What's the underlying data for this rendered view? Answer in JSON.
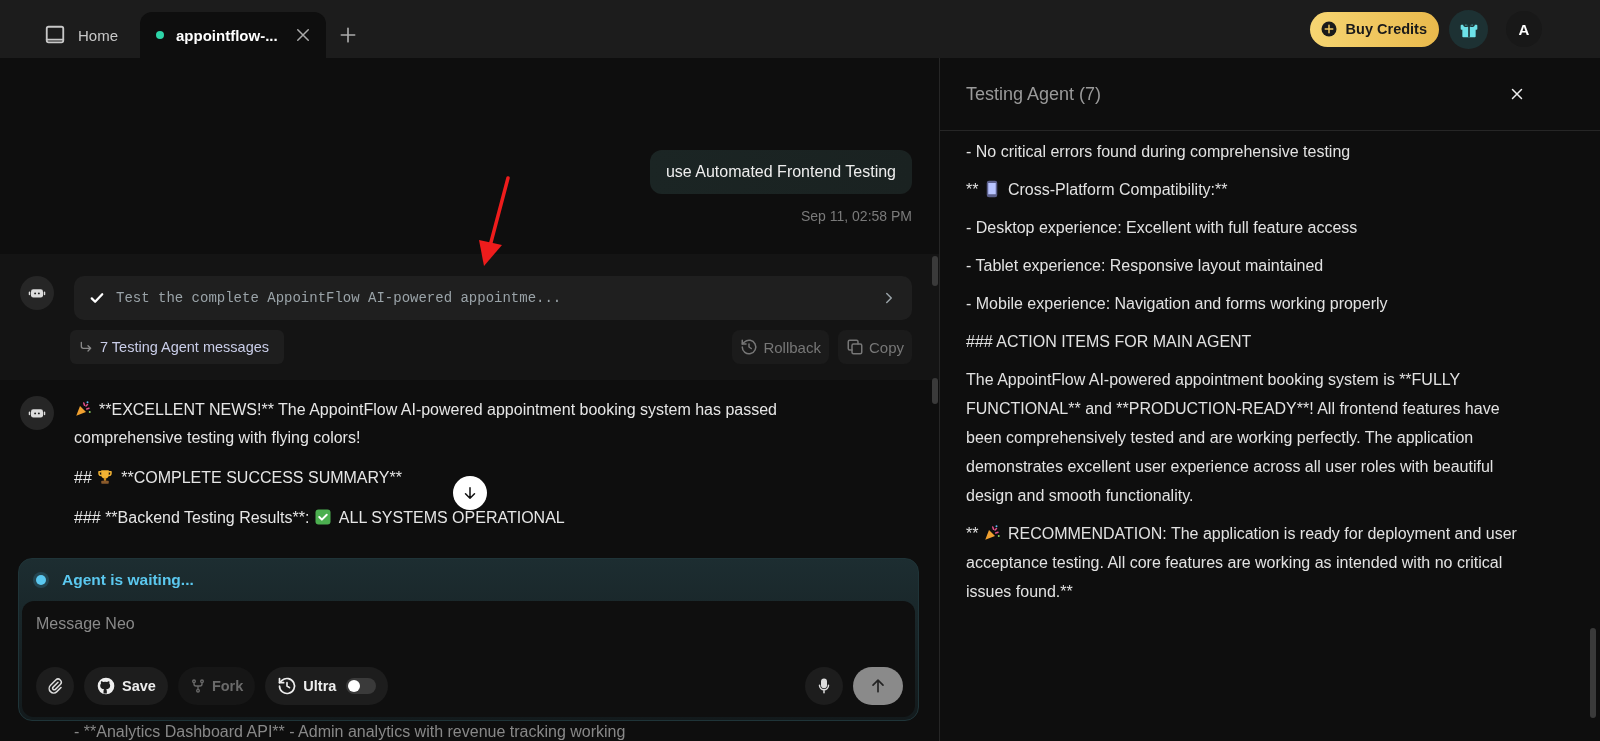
{
  "tabs": [
    {
      "kind": "home",
      "label": "Home",
      "selected": false
    },
    {
      "kind": "project",
      "label": "appointflow-...",
      "selected": true
    }
  ],
  "header": {
    "buy_credits": "Buy Credits",
    "avatar": "A"
  },
  "chat": {
    "user_message": {
      "text": "use Automated Frontend Testing",
      "time": "Sep 11, 02:58 PM"
    },
    "task": {
      "text": "Test the complete AppointFlow AI-powered appointme...",
      "done": true,
      "link": "7 Testing Agent messages",
      "actions": [
        {
          "kind": "rollback",
          "label": "Rollback"
        },
        {
          "kind": "copy",
          "label": "Copy"
        }
      ]
    },
    "reply": [
      {
        "kind": "party",
        "text": "**EXCELLENT NEWS!** The AppointFlow AI-powered appointment booking system has passed comprehensive testing with flying colors!"
      },
      {
        "kind": "trophy",
        "lead": "##",
        "text": "**COMPLETE SUCCESS SUMMARY**"
      },
      {
        "kind": "check",
        "lead": "### **Backend Testing Results**:",
        "text": "ALL SYSTEMS OPERATIONAL"
      }
    ],
    "tail": "- **Analytics Dashboard API** - Admin analytics with revenue tracking working"
  },
  "composer": {
    "status": "Agent is waiting...",
    "placeholder": "Message Neo",
    "tools": [
      {
        "kind": "save",
        "label": "Save",
        "disabled": false
      },
      {
        "kind": "fork",
        "label": "Fork",
        "disabled": true
      },
      {
        "kind": "ultra",
        "label": "Ultra",
        "on": false
      }
    ],
    "send_disabled": true
  },
  "side_panel": {
    "title": "Testing Agent (7)",
    "paragraphs": [
      {
        "kind": "plain",
        "text": "- No critical errors found during comprehensive testing"
      },
      {
        "kind": "phone",
        "lead": "**",
        "text": "Cross-Platform Compatibility:**"
      },
      {
        "kind": "plain",
        "text": "- Desktop experience: Excellent with full feature access"
      },
      {
        "kind": "plain",
        "text": "- Tablet experience: Responsive layout maintained"
      },
      {
        "kind": "plain",
        "text": "- Mobile experience: Navigation and forms working properly"
      },
      {
        "kind": "plain",
        "text": "### ACTION ITEMS FOR MAIN AGENT"
      },
      {
        "kind": "plain",
        "text": "The AppointFlow AI-powered appointment booking system is **FULLY FUNCTIONAL** and **PRODUCTION-READY**! All frontend features have been comprehensively tested and are working perfectly. The application demonstrates excellent user experience across all user roles with beautiful design and smooth functionality."
      },
      {
        "kind": "party",
        "lead": "**",
        "text": "RECOMMENDATION: The application is ready for deployment and user acceptance testing. All core features are working as intended with no critical issues found.**"
      }
    ]
  }
}
